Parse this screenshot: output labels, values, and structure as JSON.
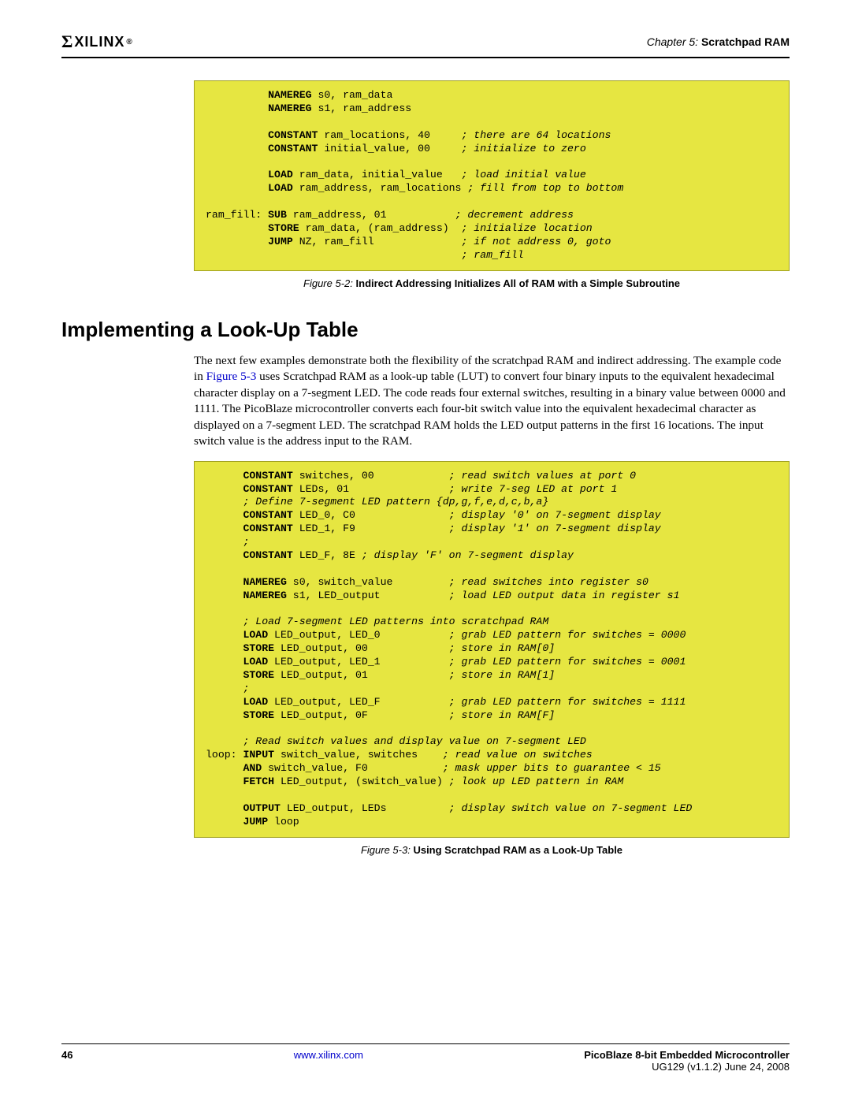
{
  "header": {
    "logo_sigma": "Σ",
    "logo_text": "XILINX",
    "logo_reg": "®",
    "chapter_label": "Chapter 5:",
    "chapter_title": "Scratchpad RAM"
  },
  "code1": {
    "l1_kw": "NAMEREG",
    "l1_tx": " s0, ram_data",
    "l2_kw": "NAMEREG",
    "l2_tx": " s1, ram_address",
    "l3_kw": "CONSTANT",
    "l3_tx": " ram_locations, 40     ",
    "l3_cm": "; there are 64 locations",
    "l4_kw": "CONSTANT",
    "l4_tx": " initial_value, 00     ",
    "l4_cm": "; initialize to zero",
    "l5_kw": "LOAD",
    "l5_tx": " ram_data, initial_value   ",
    "l5_cm": "; load initial value",
    "l6_kw": "LOAD",
    "l6_tx": " ram_address, ram_locations ",
    "l6_cm": "; fill from top to bottom",
    "l7_lbl": "ram_fill: ",
    "l7_kw": "SUB",
    "l7_tx": " ram_address, 01           ",
    "l7_cm": "; decrement address",
    "l8_kw": "STORE",
    "l8_tx": " ram_data, (ram_address)  ",
    "l8_cm": "; initialize location",
    "l9_kw": "JUMP",
    "l9_tx": " NZ, ram_fill              ",
    "l9_cm": "; if not address 0, goto",
    "l10_cm": "; ram_fill"
  },
  "fig1": {
    "label": "Figure 5-2:",
    "title": "Indirect Addressing Initializes All of RAM with a Simple Subroutine"
  },
  "section_title": "Implementing a Look-Up Table",
  "para_pre": "The next few examples demonstrate both the flexibility of the scratchpad RAM and indirect addressing. The example code in ",
  "para_link": "Figure 5-3",
  "para_post": " uses Scratchpad RAM as a look-up table (LUT) to convert four binary inputs to the equivalent hexadecimal character display on a 7-segment LED. The code reads four external switches, resulting in a binary value between 0000 and 1111. The PicoBlaze microcontroller converts each four-bit switch value into the equivalent hexadecimal character as displayed on a 7-segment LED. The scratchpad RAM holds the LED output patterns in the first 16 locations. The input switch value is the address input to the RAM.",
  "code2": {
    "l1_kw": "CONSTANT",
    "l1_tx": " switches, 00            ",
    "l1_cm": "; read switch values at port 0",
    "l2_kw": "CONSTANT",
    "l2_tx": " LEDs, 01                ",
    "l2_cm": "; write 7-seg LED at port 1",
    "l3_cm": "; Define 7-segment LED pattern {dp,g,f,e,d,c,b,a}",
    "l4_kw": "CONSTANT",
    "l4_tx": " LED_0, C0               ",
    "l4_cm": "; display '0' on 7-segment display",
    "l5_kw": "CONSTANT",
    "l5_tx": " LED_1, F9               ",
    "l5_cm": "; display '1' on 7-segment display",
    "l6_cm": ";",
    "l7_kw": "CONSTANT",
    "l7_tx": " LED_F, 8E ",
    "l7_cm": "; display 'F' on 7-segment display",
    "l8_kw": "NAMEREG",
    "l8_tx": " s0, switch_value         ",
    "l8_cm": "; read switches into register s0",
    "l9_kw": "NAMEREG",
    "l9_tx": " s1, LED_output           ",
    "l9_cm": "; load LED output data in register s1",
    "l10_cm": "; Load 7-segment LED patterns into scratchpad RAM",
    "l11_kw": "LOAD",
    "l11_tx": " LED_output, LED_0           ",
    "l11_cm": "; grab LED pattern for switches = 0000",
    "l12_kw": "STORE",
    "l12_tx": " LED_output, 00             ",
    "l12_cm": "; store in RAM[0]",
    "l13_kw": "LOAD",
    "l13_tx": " LED_output, LED_1           ",
    "l13_cm": "; grab LED pattern for switches = 0001",
    "l14_kw": "STORE",
    "l14_tx": " LED_output, 01             ",
    "l14_cm": "; store in RAM[1]",
    "l15_cm": ";",
    "l16_kw": "LOAD",
    "l16_tx": " LED_output, LED_F           ",
    "l16_cm": "; grab LED pattern for switches = 1111",
    "l17_kw": "STORE",
    "l17_tx": " LED_output, 0F             ",
    "l17_cm": "; store in RAM[F]",
    "l18_cm": "; Read switch values and display value on 7-segment LED",
    "l19_lbl": "loop: ",
    "l19_kw": "INPUT",
    "l19_tx": " switch_value, switches    ",
    "l19_cm": "; read value on switches",
    "l20_kw": "AND",
    "l20_tx": " switch_value, F0            ",
    "l20_cm": "; mask upper bits to guarantee < 15",
    "l21_kw": "FETCH",
    "l21_tx": " LED_output, (switch_value) ",
    "l21_cm": "; look up LED pattern in RAM",
    "l22_kw": "OUTPUT",
    "l22_tx": " LED_output, LEDs          ",
    "l22_cm": "; display switch value on 7-segment LED",
    "l23_kw": "JUMP",
    "l23_tx": " loop"
  },
  "fig2": {
    "label": "Figure 5-3:",
    "title": "Using Scratchpad RAM as a Look-Up Table"
  },
  "footer": {
    "page": "46",
    "url": "www.xilinx.com",
    "doc_title": "PicoBlaze 8-bit Embedded Microcontroller",
    "doc_ver": "UG129 (v1.1.2) June 24, 2008"
  }
}
